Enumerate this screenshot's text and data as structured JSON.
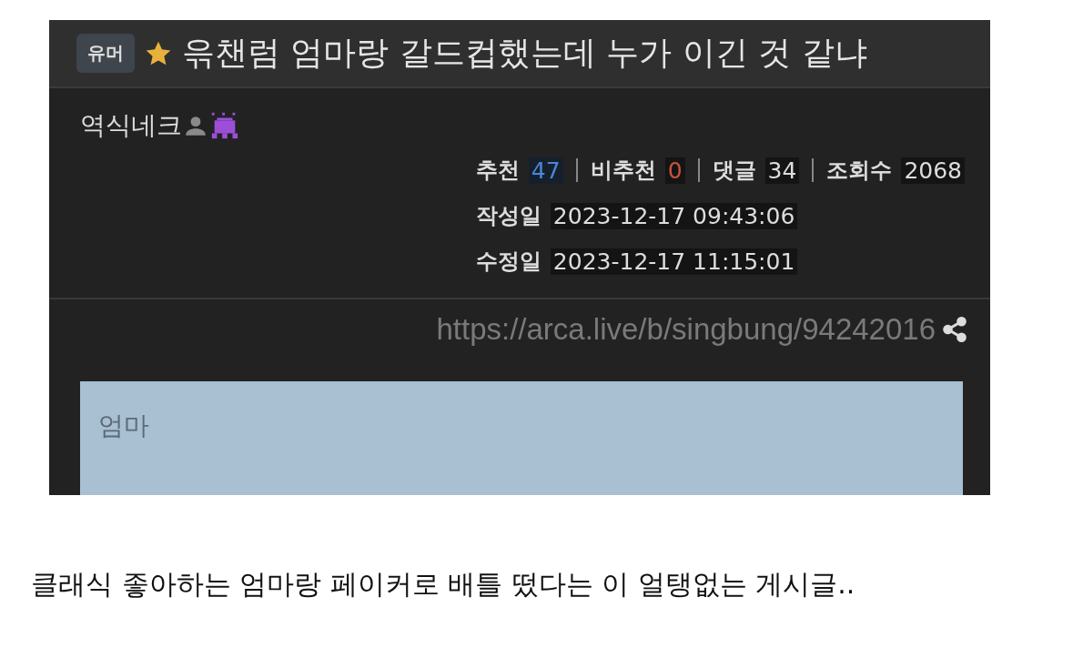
{
  "post": {
    "category": "유머",
    "title": "윾챈럼 엄마랑 갈드컵했는데 누가 이긴 것 같냐",
    "author": "역식네크",
    "stats": [
      {
        "label": "추천",
        "value": "47",
        "kind": "up"
      },
      {
        "label": "비추천",
        "value": "0",
        "kind": "down"
      },
      {
        "label": "댓글",
        "value": "34",
        "kind": "plain"
      },
      {
        "label": "조회수",
        "value": "2068",
        "kind": "plain"
      }
    ],
    "dates": [
      {
        "label": "작성일",
        "value": "2023-12-17 09:43:06"
      },
      {
        "label": "수정일",
        "value": "2023-12-17 11:15:01"
      }
    ],
    "url": "https://arca.live/b/singbung/94242016",
    "quote": "엄마"
  },
  "caption": "클래식 좋아하는 엄마랑 페이커로 배틀 떴다는 이 얼탱없는 게시글.."
}
